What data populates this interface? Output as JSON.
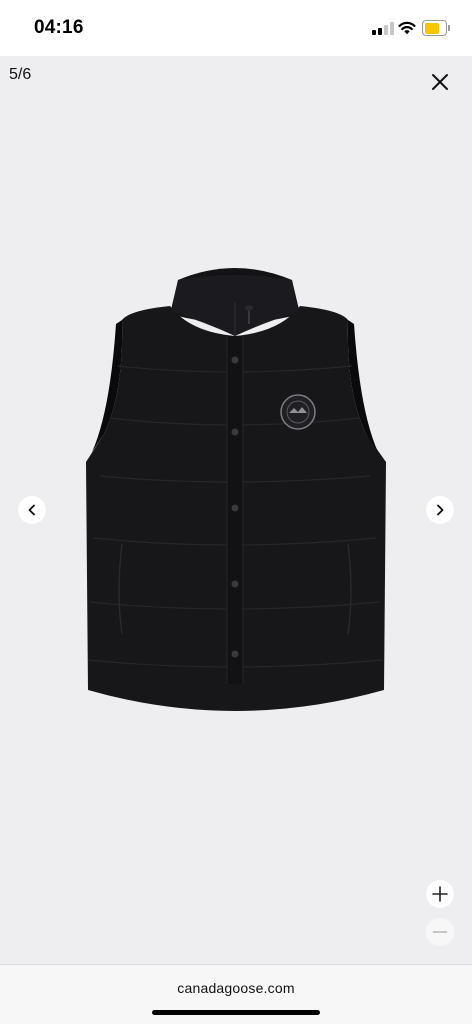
{
  "status_bar": {
    "time": "04:16",
    "signal_icon": "cellular-signal-icon",
    "wifi_icon": "wifi-icon",
    "battery_icon": "battery-icon",
    "battery_color": "#f7c600"
  },
  "viewer": {
    "counter": "5/6",
    "background": "#eeeef0",
    "close_icon": "close-icon",
    "prev_icon": "chevron-left-icon",
    "next_icon": "chevron-right-icon",
    "zoom_in_icon": "plus-icon",
    "zoom_out_icon": "minus-icon",
    "product_image": "black-puffer-vest-image"
  },
  "browser": {
    "domain": "canadagoose.com"
  }
}
